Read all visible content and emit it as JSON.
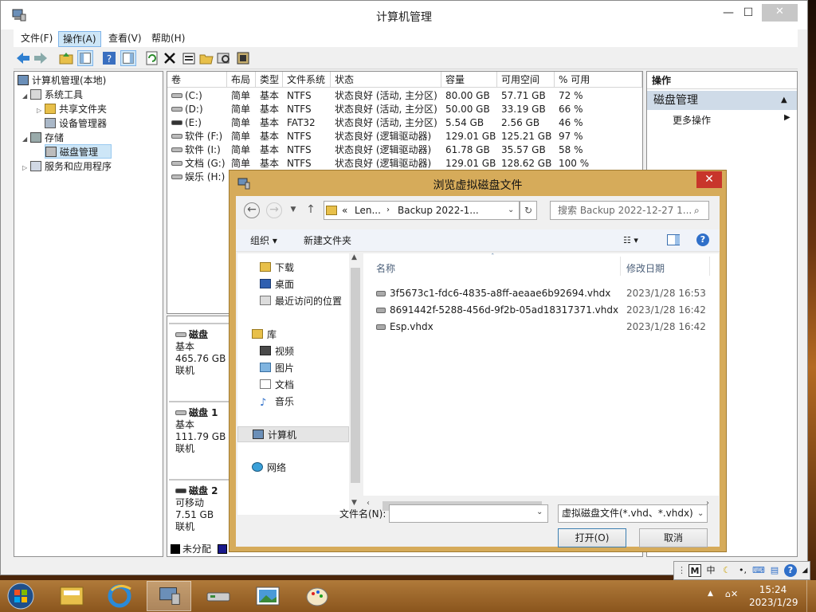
{
  "main_window": {
    "title": "计算机管理",
    "controls": {
      "minimize": "—",
      "maximize": "☐",
      "close": "✕"
    },
    "menu": [
      "文件(F)",
      "操作(A)",
      "查看(V)",
      "帮助(H)"
    ]
  },
  "tree": [
    {
      "label": "计算机管理(本地)"
    },
    {
      "label": "系统工具"
    },
    {
      "label": "共享文件夹"
    },
    {
      "label": "设备管理器"
    },
    {
      "label": "存储"
    },
    {
      "label": "磁盘管理"
    },
    {
      "label": "服务和应用程序"
    }
  ],
  "volume_list": {
    "columns": [
      "卷",
      "布局",
      "类型",
      "文件系统",
      "状态",
      "容量",
      "可用空间",
      "% 可用"
    ],
    "rows": [
      [
        "(C:)",
        "简单",
        "基本",
        "NTFS",
        "状态良好 (活动, 主分区)",
        "80.00 GB",
        "57.71 GB",
        "72 %"
      ],
      [
        "(D:)",
        "简单",
        "基本",
        "NTFS",
        "状态良好 (活动, 主分区)",
        "50.00 GB",
        "33.19 GB",
        "66 %"
      ],
      [
        "(E:)",
        "简单",
        "基本",
        "FAT32",
        "状态良好 (活动, 主分区)",
        "5.54 GB",
        "2.56 GB",
        "46 %"
      ],
      [
        "软件 (F:)",
        "简单",
        "基本",
        "NTFS",
        "状态良好 (逻辑驱动器)",
        "129.01 GB",
        "125.21 GB",
        "97 %"
      ],
      [
        "软件 (I:)",
        "简单",
        "基本",
        "NTFS",
        "状态良好 (逻辑驱动器)",
        "61.78 GB",
        "35.57 GB",
        "58 %"
      ],
      [
        "文档 (G:)",
        "简单",
        "基本",
        "NTFS",
        "状态良好 (逻辑驱动器)",
        "129.01 GB",
        "128.62 GB",
        "100 %"
      ],
      [
        "娱乐 (H:)",
        "",
        "",
        "",
        "",
        "",
        "",
        ""
      ]
    ]
  },
  "disks": [
    {
      "name": "磁盘",
      "type": "基本",
      "size": "465.76 GB",
      "status": "联机"
    },
    {
      "name": "磁盘 1",
      "type": "基本",
      "size": "111.79 GB",
      "status": "联机"
    },
    {
      "name": "磁盘 2",
      "type": "可移动",
      "size": "7.51 GB",
      "status": "联机"
    }
  ],
  "legend": {
    "unallocated": "未分配"
  },
  "actions": {
    "header": "操作",
    "section": "磁盘管理",
    "more": "更多操作"
  },
  "dialog": {
    "title": "浏览虚拟磁盘文件",
    "close": "✕",
    "breadcrumb": [
      "Len...",
      "Backup 2022-1..."
    ],
    "breadcrumb_prefix": "«",
    "search_placeholder": "搜索 Backup 2022-12-27 1...",
    "organize": "组织 ▾",
    "new_folder": "新建文件夹",
    "nav": {
      "quick": [
        "下载",
        "桌面",
        "最近访问的位置"
      ],
      "library": "库",
      "library_items": [
        "视频",
        "图片",
        "文档",
        "音乐"
      ],
      "computer": "计算机",
      "network": "网络"
    },
    "columns": {
      "name": "名称",
      "date": "修改日期"
    },
    "files": [
      {
        "name": "3f5673c1-fdc6-4835-a8ff-aeaae6b92694.vhdx",
        "date": "2023/1/28 16:53"
      },
      {
        "name": "8691442f-5288-456d-9f2b-05ad18317371.vhdx",
        "date": "2023/1/28 16:42"
      },
      {
        "name": "Esp.vhdx",
        "date": "2023/1/28 16:42"
      }
    ],
    "filename_label": "文件名(N):",
    "filename_value": "",
    "filter": "虚拟磁盘文件(*.vhd、*.vhdx)",
    "open_button": "打开(O)",
    "cancel_button": "取消"
  },
  "langbar": {
    "m": "M",
    "zh": "中"
  },
  "taskbar": {
    "time": "15:24",
    "date": "2023/1/29"
  },
  "colors": {
    "accent": "#cde6f7",
    "dialog_frame": "#d6ab5a",
    "close_red": "#c8352b"
  }
}
